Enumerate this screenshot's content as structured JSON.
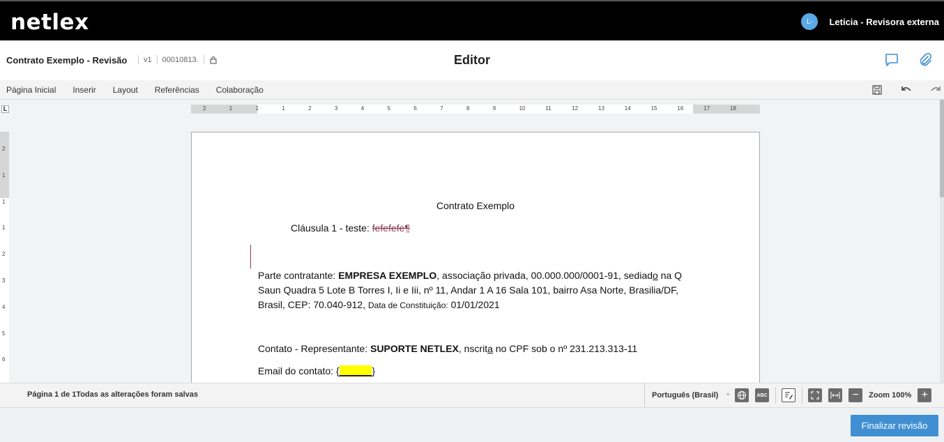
{
  "brand": {
    "logo_text": "netlex"
  },
  "user": {
    "initials": "L-",
    "name": "Leticia - Revisora externa"
  },
  "document": {
    "title": "Contrato Exemplo - Revisão",
    "version": "v1",
    "code": "00010813.",
    "editor_title": "Editor"
  },
  "menu": {
    "items": [
      "Página Inicial",
      "Inserir",
      "Layout",
      "Referências",
      "Colaboração"
    ]
  },
  "ruler": {
    "h_labels": [
      "2",
      "1",
      "1",
      "1",
      "2",
      "3",
      "4",
      "5",
      "6",
      "7",
      "8",
      "9",
      "10",
      "11",
      "12",
      "13",
      "14",
      "15",
      "16",
      "17",
      "18"
    ],
    "v_labels": [
      "2",
      "1",
      "1",
      "1",
      "2",
      "3",
      "4",
      "5",
      "6"
    ]
  },
  "content": {
    "heading": "Contrato Exemplo",
    "clause_prefix": "Cláusula 1 - teste: ",
    "clause_deleted": "fefefefe¶",
    "p1_prefix": "Parte contratante: ",
    "p1_company": "EMPRESA EXEMPLO",
    "p1_body_a": ", associação privada, 00.000.000/0001-91, sediad",
    "p1_underlined": "o",
    "p1_body_b": " na Q Saun Quadra 5 Lote B Torres I, Ii e Iii, nº 11, Andar 1 A 16 Sala 101, bairro Asa Norte, Brasilia/DF, Brasil, CEP: 70.040-912, ",
    "p1_small": "Data de Constituição:",
    "p1_date": " 01/01/2021",
    "p2_prefix": "Contato - Representante: ",
    "p2_name": "SUPORTE NETLEX",
    "p2_body_a": ", nscrit",
    "p2_underlined": "a",
    "p2_body_b": " no CPF sob o nº 231.213.313-11",
    "p3_prefix": "Email do contato: {",
    "p3_field": "______",
    "p3_suffix": "}"
  },
  "status": {
    "text": "Página 1 de 1Todas as alterações foram salvas",
    "language": "Português (Brasil)",
    "zoom": "Zoom 100%"
  },
  "footer": {
    "finish_label": "Finalizar revisão"
  },
  "colors": {
    "accent": "#3f8fd2",
    "deleted": "#8b3a52",
    "highlight": "#ffff00",
    "topbar": "#000000"
  },
  "icons": [
    "chat-icon",
    "paperclip-icon",
    "lock-icon",
    "save-icon",
    "undo-icon",
    "redo-icon",
    "globe-icon",
    "spellcheck-icon",
    "track-changes-icon",
    "fit-page-icon",
    "fit-width-icon",
    "zoom-out-icon",
    "zoom-in-icon"
  ]
}
